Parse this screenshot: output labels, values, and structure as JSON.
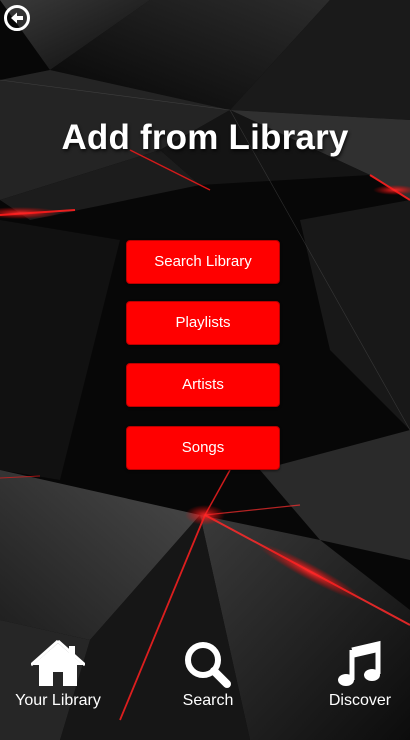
{
  "page": {
    "title": "Add from Library"
  },
  "header": {
    "back_icon": "arrow-left-circle-icon"
  },
  "menu": {
    "items": [
      {
        "label": "Search Library"
      },
      {
        "label": "Playlists"
      },
      {
        "label": "Artists"
      },
      {
        "label": "Songs"
      }
    ]
  },
  "nav": {
    "items": [
      {
        "label": "Your Library",
        "icon": "home-icon"
      },
      {
        "label": "Search",
        "icon": "search-icon"
      },
      {
        "label": "Discover",
        "icon": "music-note-icon"
      }
    ]
  },
  "colors": {
    "accent": "#ff0000",
    "background": "#080808",
    "text": "#ffffff"
  }
}
